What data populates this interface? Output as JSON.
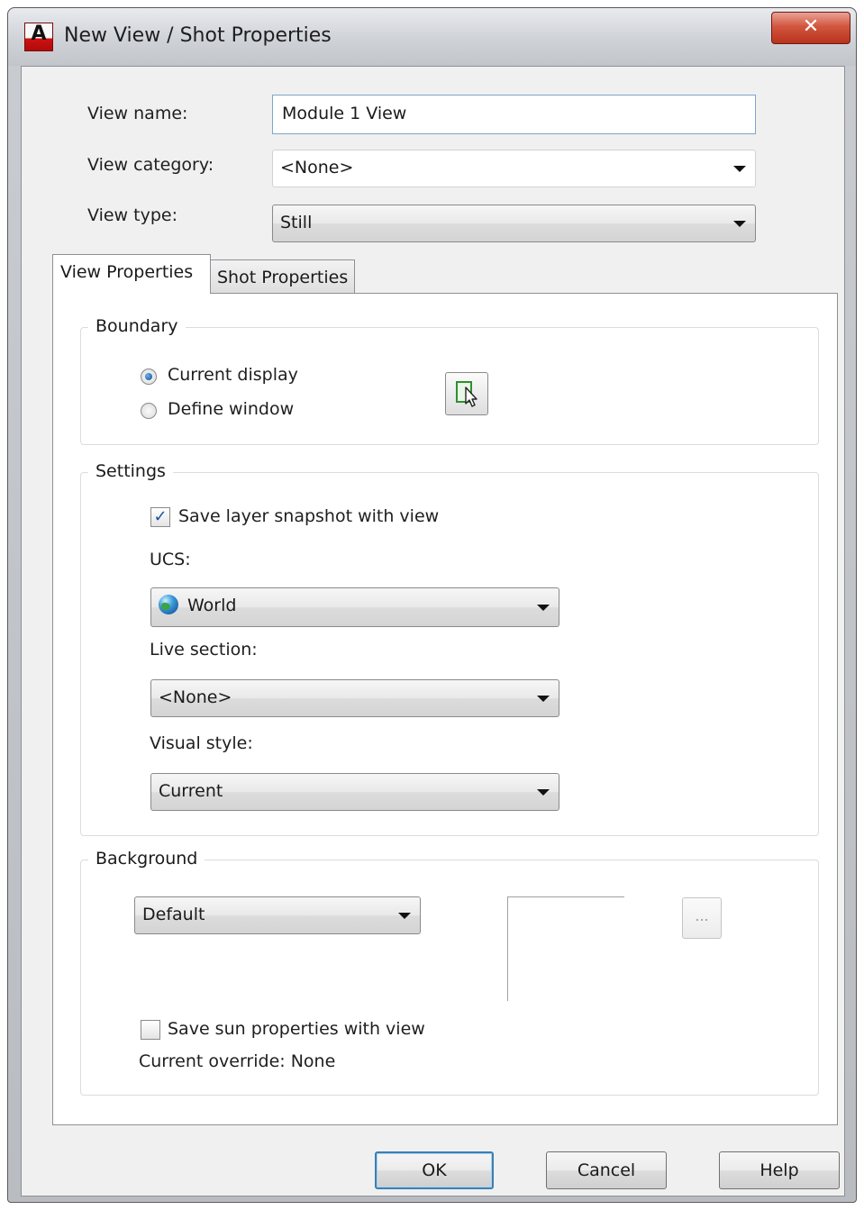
{
  "window": {
    "title": "New View / Shot Properties",
    "app_icon": "autocad-logo-icon",
    "app_icon_letter": "A",
    "close_glyph": "✕"
  },
  "form": {
    "view_name_label": "View name:",
    "view_name_value": "Module 1 View",
    "view_category_label": "View category:",
    "view_category_value": "<None>",
    "view_type_label": "View type:",
    "view_type_value": "Still"
  },
  "tabs": [
    {
      "label": "View Properties",
      "active": true
    },
    {
      "label": "Shot Properties",
      "active": false
    }
  ],
  "boundary": {
    "title": "Boundary",
    "options": [
      {
        "label": "Current display",
        "selected": true
      },
      {
        "label": "Define window",
        "selected": false
      }
    ],
    "pick_button_icon": "define-window-pick-icon"
  },
  "settings": {
    "title": "Settings",
    "save_layer_snapshot_label": "Save layer snapshot with view",
    "save_layer_snapshot_checked": true,
    "ucs_label": "UCS:",
    "ucs_value": "World",
    "ucs_icon": "globe-icon",
    "live_section_label": "Live section:",
    "live_section_value": "<None>",
    "visual_style_label": "Visual style:",
    "visual_style_value": "Current"
  },
  "background": {
    "title": "Background",
    "value": "Default",
    "browse_label": "...",
    "save_sun_label": "Save sun properties with view",
    "save_sun_checked": false,
    "current_override": "Current override: None"
  },
  "buttons": {
    "ok": "OK",
    "cancel": "Cancel",
    "help": "Help"
  },
  "colors": {
    "default_button_border": "#3c7fb1",
    "close_button": "#c8452c",
    "checkbox_mark": "#1e4fa0"
  }
}
